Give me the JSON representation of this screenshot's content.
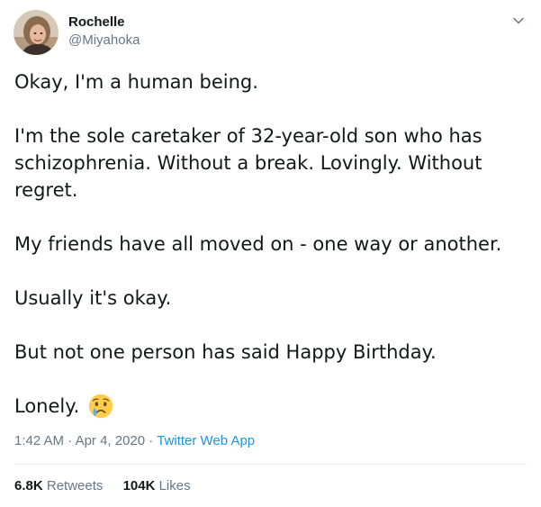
{
  "user": {
    "name": "Rochelle",
    "handle": "@Miyahoka"
  },
  "tweet": {
    "paragraphs": [
      "Okay, I'm a human being.",
      "I'm the sole caretaker of 32-year-old son who has schizophrenia.  Without a break.  Lovingly. Without regret.",
      "My friends have all moved on - one way or another.",
      "Usually it's okay.",
      "But not one person has said Happy Birthday.",
      "Lonely."
    ],
    "emoji": "crying-face-emoji"
  },
  "meta": {
    "time": "1:42 AM",
    "separator1": " · ",
    "date": "Apr 4, 2020",
    "separator2": " · ",
    "source": "Twitter Web App"
  },
  "stats": {
    "retweets_count": "6.8K",
    "retweets_label": "Retweets",
    "likes_count": "104K",
    "likes_label": "Likes"
  },
  "colors": {
    "text": "#14171a",
    "secondary": "#657786",
    "link": "#1b95e0",
    "divider": "#e6ecf0"
  }
}
